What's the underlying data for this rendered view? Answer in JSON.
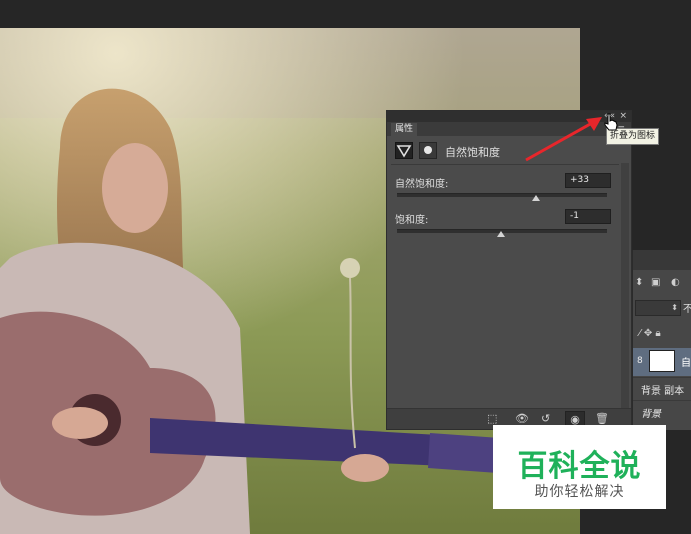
{
  "panel": {
    "tab_label": "属性",
    "menu_icon": "panel-menu-icon",
    "collapse_btn": "««",
    "close_btn": "×",
    "adjustment_title": "自然饱和度",
    "vibrance": {
      "label": "自然饱和度:",
      "value": "+33",
      "level": 0.66
    },
    "saturation": {
      "label": "饱和度:",
      "value": "-1",
      "level": 0.495
    },
    "bottom_icons": [
      "clip-to-layer-icon",
      "view-previous-icon",
      "reset-icon",
      "visibility-icon",
      "trash-icon"
    ]
  },
  "tooltip": {
    "text": "折叠为图标"
  },
  "layers": {
    "selected_layer": "自",
    "opacity_label": "不",
    "layer_copy": "背景 副本",
    "layer_bg": "背景"
  },
  "watermark": {
    "title": "百科全说",
    "subtitle": "助你轻松解决"
  },
  "colors": {
    "panel_bg": "#4b4b4b",
    "arrow": "#e8262b",
    "watermark_green": "#1fb15a",
    "selection": "#5f6d80"
  }
}
